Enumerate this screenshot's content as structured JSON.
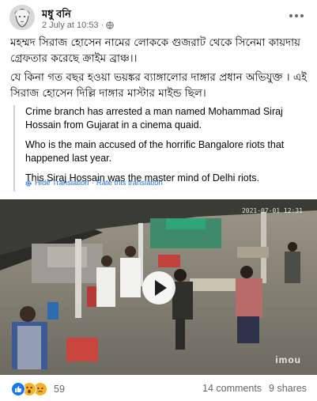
{
  "header": {
    "author": "মধু বনি",
    "time": "2 July at 10:53",
    "privacy_icon": "globe-icon",
    "more_icon": "more-options-icon"
  },
  "post": {
    "lines": [
      "মহম্মদ সিরাজ হোসেন নামের লোককে গুজরাট থেকে সিনেমা কায়দায় গ্রেফতার করেছে ক্রাইম ব্রাঞ্চ।।",
      "যে কিনা গত বছর হওয়া ভয়ঙ্কর ব্যাঙ্গালোর দাঙ্গার প্রধান অভিযুক্ত । এই সিরাজ হোসেন দিল্লি দাঙ্গার মাস্টার মাইন্ড ছিল।"
    ]
  },
  "translation": {
    "lines": [
      "Crime branch has arrested a man named Mohammad Siraj Hossain from Gujarat in a cinema quaid.",
      "Who is the main accused of the horrific Bangalore riots that happened last year.",
      "This Siraj Hossain was the master mind of Delhi riots."
    ],
    "hide_label": "Hide Translation",
    "separator": "·",
    "rate_label": "Rate this translation"
  },
  "video": {
    "watermark": "imou",
    "timestamp": "2021-07-01 12:31"
  },
  "footer": {
    "reaction_count": "59",
    "comments": "14 comments",
    "shares": "9 shares",
    "reaction_icons": [
      "like-icon",
      "wow-icon",
      "sad-icon"
    ]
  },
  "colors": {
    "link": "#216fdb",
    "secondary": "#65676b",
    "like": "#1877f2",
    "wow": "#f7b125"
  }
}
